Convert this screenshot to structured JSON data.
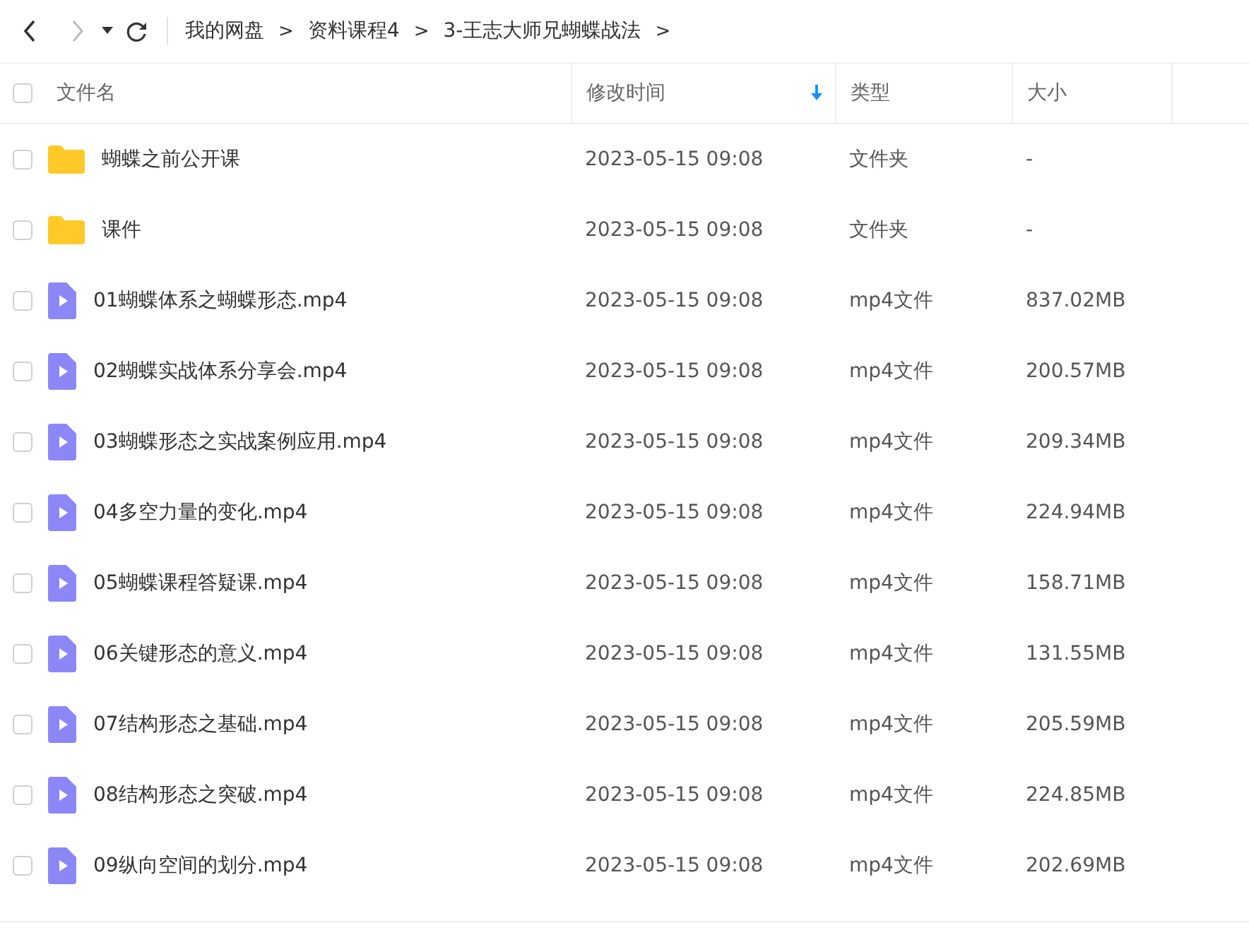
{
  "breadcrumb": [
    {
      "label": "我的网盘"
    },
    {
      "label": "资料课程4"
    },
    {
      "label": "3-王志大师兄蝴蝶战法"
    }
  ],
  "breadcrumb_separator": ">",
  "select_all": {
    "checked": false
  },
  "columns": [
    {
      "label": "文件名",
      "sorted": false
    },
    {
      "label": "修改时间",
      "sorted": true
    },
    {
      "label": "类型",
      "sorted": false
    },
    {
      "label": "大小",
      "sorted": false
    }
  ],
  "rows": [
    {
      "kind": "folder",
      "checked": false,
      "name": "蝴蝶之前公开课",
      "modified": "2023-05-15 09:08",
      "type": "文件夹",
      "size": "-"
    },
    {
      "kind": "folder",
      "checked": false,
      "name": "课件",
      "modified": "2023-05-15 09:08",
      "type": "文件夹",
      "size": "-"
    },
    {
      "kind": "video",
      "checked": false,
      "name": "01蝴蝶体系之蝴蝶形态.mp4",
      "modified": "2023-05-15 09:08",
      "type": "mp4文件",
      "size": "837.02MB"
    },
    {
      "kind": "video",
      "checked": false,
      "name": "02蝴蝶实战体系分享会.mp4",
      "modified": "2023-05-15 09:08",
      "type": "mp4文件",
      "size": "200.57MB"
    },
    {
      "kind": "video",
      "checked": false,
      "name": "03蝴蝶形态之实战案例应用.mp4",
      "modified": "2023-05-15 09:08",
      "type": "mp4文件",
      "size": "209.34MB"
    },
    {
      "kind": "video",
      "checked": false,
      "name": "04多空力量的变化.mp4",
      "modified": "2023-05-15 09:08",
      "type": "mp4文件",
      "size": "224.94MB"
    },
    {
      "kind": "video",
      "checked": false,
      "name": "05蝴蝶课程答疑课.mp4",
      "modified": "2023-05-15 09:08",
      "type": "mp4文件",
      "size": "158.71MB"
    },
    {
      "kind": "video",
      "checked": false,
      "name": "06关键形态的意义.mp4",
      "modified": "2023-05-15 09:08",
      "type": "mp4文件",
      "size": "131.55MB"
    },
    {
      "kind": "video",
      "checked": false,
      "name": "07结构形态之基础.mp4",
      "modified": "2023-05-15 09:08",
      "type": "mp4文件",
      "size": "205.59MB"
    },
    {
      "kind": "video",
      "checked": false,
      "name": "08结构形态之突破.mp4",
      "modified": "2023-05-15 09:08",
      "type": "mp4文件",
      "size": "224.85MB"
    },
    {
      "kind": "video",
      "checked": false,
      "name": "09纵向空间的划分.mp4",
      "modified": "2023-05-15 09:08",
      "type": "mp4文件",
      "size": "202.69MB"
    }
  ]
}
